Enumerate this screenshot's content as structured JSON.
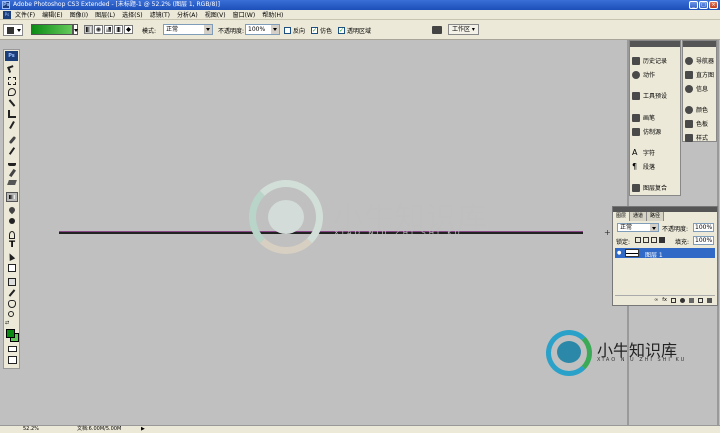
{
  "window": {
    "title": "Adobe Photoshop CS3 Extended - [未标题-1 @ 52.2% (图层 1, RGB/8)]",
    "app_icon": "Ps",
    "controls": [
      "minimize-icon",
      "maximize-icon",
      "close-icon"
    ]
  },
  "menu": {
    "badge": "Ps",
    "items": [
      "文件(F)",
      "编辑(E)",
      "图像(I)",
      "图层(L)",
      "选择(S)",
      "滤镜(T)",
      "分析(A)",
      "视图(V)",
      "窗口(W)",
      "帮助(H)"
    ]
  },
  "options": {
    "mode_label": "模式:",
    "mode_value": "正常",
    "opacity_label": "不透明度:",
    "opacity_value": "100%",
    "reverse_label": "反向",
    "dither_label": "仿色",
    "transparency_label": "透明区域",
    "workspace_label": "工作区",
    "gradient_colors": [
      "#0c8c14",
      "#65c95c"
    ]
  },
  "toolbox": {
    "badge": "Ps",
    "tools": [
      "move-tool-icon",
      "marquee-tool-icon",
      "lasso-tool-icon",
      "magic-wand-icon",
      "crop-tool-icon",
      "slice-tool-icon",
      "healing-brush-icon",
      "brush-tool-icon",
      "clone-stamp-icon",
      "history-brush-icon",
      "eraser-tool-icon",
      "gradient-tool-icon",
      "blur-tool-icon",
      "dodge-tool-icon",
      "pen-tool-icon",
      "type-tool-icon",
      "path-select-icon",
      "shape-tool-icon",
      "notes-tool-icon",
      "eyedropper-icon",
      "hand-tool-icon",
      "zoom-tool-icon"
    ],
    "foreground_color": "#0a8a10",
    "background_color": "#62c45a"
  },
  "watermark": {
    "main": "小牛知识库",
    "sub": "XIAO NIU ZHI SHI KU"
  },
  "panels": {
    "col1": [
      {
        "label": "历史记录",
        "icon": "history-icon"
      },
      {
        "label": "动作",
        "icon": "actions-icon"
      },
      {
        "label": "工具预设",
        "icon": "tool-presets-icon"
      },
      {
        "label": "画笔",
        "icon": "brushes-icon"
      },
      {
        "label": "仿制源",
        "icon": "clone-source-icon"
      },
      {
        "label": "字符",
        "icon": "character-icon"
      },
      {
        "label": "段落",
        "icon": "paragraph-icon"
      },
      {
        "label": "图层复合",
        "icon": "layer-comps-icon"
      }
    ],
    "col2": [
      {
        "label": "导航器",
        "icon": "navigator-icon"
      },
      {
        "label": "直方图",
        "icon": "histogram-icon"
      },
      {
        "label": "信息",
        "icon": "info-icon"
      },
      {
        "label": "颜色",
        "icon": "color-icon"
      },
      {
        "label": "色板",
        "icon": "swatches-icon"
      },
      {
        "label": "样式",
        "icon": "styles-icon"
      }
    ]
  },
  "layers": {
    "tabs": [
      "图层",
      "通道",
      "路径"
    ],
    "blend_mode": "正常",
    "opacity_label": "不透明度:",
    "opacity_value": "100%",
    "lock_label": "锁定:",
    "fill_label": "填充:",
    "fill_value": "100%",
    "layer_name": "图层 1"
  },
  "status": {
    "zoom": "52.2%",
    "doc": "文档:6.00M/5.00M"
  }
}
